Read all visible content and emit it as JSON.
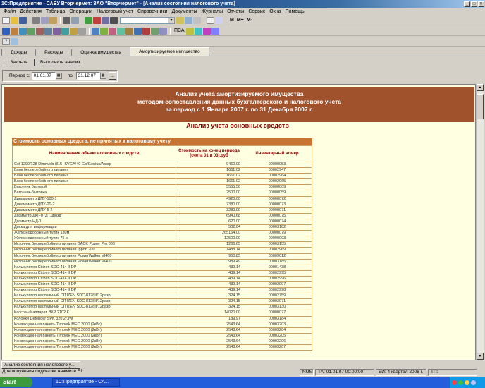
{
  "app": {
    "title": "1С:Предприятие - САБУ Вторчермет: ЗАО \"Вторчермет\" - [Анализ состояния налогового учета]"
  },
  "menu": [
    "Файл",
    "Действия",
    "Таблица",
    "Операции",
    "Налоговый учет",
    "Справочники",
    "Документы",
    "Журналы",
    "Отчеты",
    "Сервис",
    "Окна",
    "Помощь"
  ],
  "toolbar": {
    "m_label": "M",
    "m_plus_label": "M+",
    "m_minus_label": "M-",
    "pca_label": "ПСА"
  },
  "tabs": [
    "Доходы",
    "Расходы",
    "Оценка имущества",
    "Амортизируемое имущество"
  ],
  "actions": {
    "close_label": "Закрыть",
    "run_label": "Выполнить анализ"
  },
  "period": {
    "from_label": "Период с:",
    "from_value": "01.01.07",
    "to_label": "по:",
    "to_value": "31.12.07",
    "more_label": "..."
  },
  "report": {
    "banner_line1": "Анализ учета амортизируемого имущества",
    "banner_line2": "методом сопоставления данных бухгалтерского и налогового учета",
    "banner_line3": "за период с 1 Января 2007 г. по 31 Декабря 2007 г.",
    "subtitle": "Анализ учета основных средств",
    "section_title": "Стоимость основных средств, не принятых к налоговому учету",
    "columns": [
      "Наименование объекта основных средств",
      "Стоимость на конец периода (счета 01 и 03),руб",
      "Инвентарный номер"
    ],
    "rows": [
      [
        "Cel 1200/128 Dimm/db i815+SVGA/40 Gb/Genius/Acorp",
        "9460.00",
        "00000053"
      ],
      [
        "Блок бесперебойного питания",
        "1661.02",
        "00002947"
      ],
      [
        "Блок бесперебойного питания",
        "1661.02",
        "00002964"
      ],
      [
        "Блок бесперебойного питания",
        "1661.02",
        "00002965"
      ],
      [
        "Вагончик бытовой",
        "5555.56",
        "00000009"
      ],
      [
        "Вагончик-бытовка",
        "2500.00",
        "00000059"
      ],
      [
        "Динамометр ДПУ-100-1",
        "4920.00",
        "00000072"
      ],
      [
        "Динамометр ДПУ-20-2",
        "7380.00",
        "00000073"
      ],
      [
        "Динамометр ДПУ-5-2",
        "3280.00",
        "00000071"
      ],
      [
        "Дозиметр ДКГ-07Д \"Дрозд\"",
        "6940.68",
        "00000075"
      ],
      [
        "Дозиметр НД-1",
        "620.00",
        "00000074"
      ],
      [
        "Доска для информации",
        "502.04",
        "00003182"
      ],
      [
        "Железнодорожный тупик 130м",
        "265164.00",
        "00000079"
      ],
      [
        "Железнодорожный тупик 75 м",
        "12500.00",
        "00000003"
      ],
      [
        "Источник бесперебойного питания BACK Power Pro 600",
        "1266.65",
        "00003155"
      ],
      [
        "Источник бесперебойного питания Ippon 700",
        "1488.14",
        "00002969"
      ],
      [
        "Источник бесперебойного питания PowerWalker VI400",
        "950.85",
        "00003012"
      ],
      [
        "Источник бесперебойного питания PowerWalker VI400",
        "989.49",
        "00003185"
      ],
      [
        "Калькулятор Citizen SDC-414 II DP",
        "439.14",
        "00001438"
      ],
      [
        "Калькулятор Citizen SDC-414 II DP",
        "439.14",
        "00002995"
      ],
      [
        "Калькулятор Citizen SDC-414 II DP",
        "439.14",
        "00002996"
      ],
      [
        "Калькулятор Citizen SDC-414 II DP",
        "439.14",
        "00002997"
      ],
      [
        "Калькулятор Citizen SDC-414 II DP",
        "439.14",
        "00002998"
      ],
      [
        "Калькулятор настольный CITIZEN SDC-8128II/12разр",
        "324.15",
        "00002759"
      ],
      [
        "Калькулятор настольный CITIZEN SDC-8128II/12разр",
        "324.15",
        "00003071"
      ],
      [
        "Калькулятор настольный CITIZEN SDC-8128II/12разр",
        "324.15",
        "00003130"
      ],
      [
        "Кассовый аппарат ЭКР 2102 К",
        "14020.00",
        "00000077"
      ],
      [
        "Колонки Defender SPK 320 2*3W",
        "189.97",
        "00003184"
      ],
      [
        "Конвекционная панель Timberk MEC 2000 (2кВт)",
        "2543.64",
        "00003203"
      ],
      [
        "Конвекционная панель Timberk MEC 2000 (2кВт)",
        "2543.64",
        "00003204"
      ],
      [
        "Конвекционная панель Timberk MEC 2000 (2кВт)",
        "2543.64",
        "00003205"
      ],
      [
        "Конвекционная панель Timberk MEC 2000 (2кВт)",
        "2543.64",
        "00003206"
      ],
      [
        "Конвекционная панель Timberk MEC 2000 (2кВт)",
        "2543.64",
        "00003207"
      ]
    ]
  },
  "window_tab": "Анализ состояния налогового у...",
  "status": {
    "hint": "Для получения подсказки нажмите F1",
    "num": "NUM",
    "ta": "ТА: 01.01.07  00:00:00",
    "bi": "БИ: 4 квартал 2008 г.",
    "tp": "ТП:"
  },
  "taskbar": {
    "start_label": "Start",
    "task_label": "1С:Предприятие - СА..."
  }
}
